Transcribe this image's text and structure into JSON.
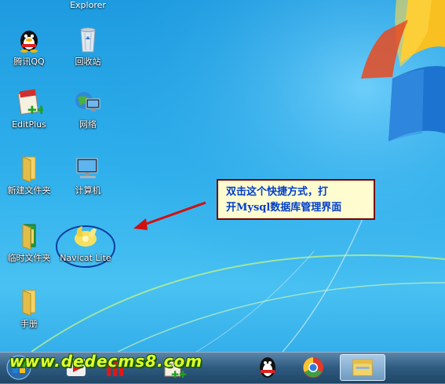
{
  "desktop": {
    "top_partial_label": "Explorer",
    "icons": [
      {
        "label": "腾讯QQ",
        "icon": "qq-penguin-icon"
      },
      {
        "label": "回收站",
        "icon": "recycle-bin-icon"
      },
      {
        "label": "EditPlus",
        "icon": "editplus-icon"
      },
      {
        "label": "网络",
        "icon": "network-icon"
      },
      {
        "label": "新建文件夹",
        "icon": "folder-icon"
      },
      {
        "label": "计算机",
        "icon": "computer-icon"
      },
      {
        "label": "临时文件夹",
        "icon": "folder-icon"
      },
      {
        "label": "Navicat Lite",
        "icon": "navicat-icon"
      },
      {
        "label": "手册",
        "icon": "folder-icon"
      }
    ]
  },
  "callout": {
    "line1": "双击这个快捷方式，打",
    "line2": "开Mysql数据库管理界面"
  },
  "watermark": {
    "text": "www.dedecms8.com"
  },
  "taskbar": {
    "items": [
      "start-orb-icon",
      "media-player-icon",
      "app-icon",
      "editplus-icon",
      "qq-penguin-icon",
      "chrome-icon",
      "explorer-folder-icon"
    ]
  },
  "colors": {
    "callout_text": "#003ecb",
    "callout_border": "#7a0000",
    "arrow": "#d01010",
    "highlight": "#0a3fa0"
  }
}
